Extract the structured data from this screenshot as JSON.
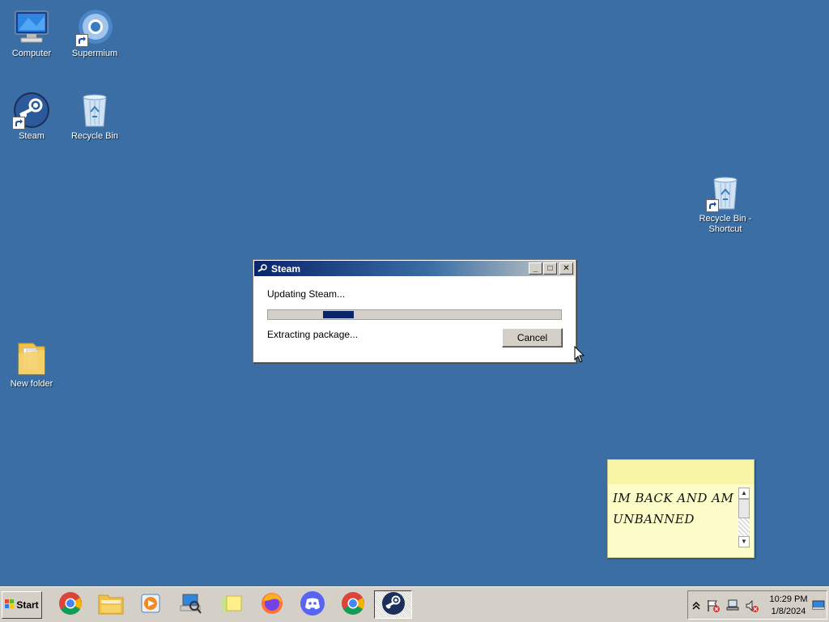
{
  "desktop": {
    "icons": [
      {
        "label": "Computer"
      },
      {
        "label": "Supermium"
      },
      {
        "label": "Steam"
      },
      {
        "label": "Recycle Bin"
      },
      {
        "label": "Recycle Bin - Shortcut"
      },
      {
        "label": "New folder"
      }
    ]
  },
  "dialog": {
    "title": "Steam",
    "status_title": "Updating Steam...",
    "status_sub": "Extracting package...",
    "cancel_label": "Cancel",
    "progress_state": "indeterminate",
    "title_buttons": [
      "minimize",
      "maximize",
      "close"
    ]
  },
  "sticky_note": {
    "text": "IM BACK AND AM UNBANNED"
  },
  "taskbar": {
    "start_label": "Start",
    "pinned": [
      "chrome-icon",
      "file-explorer-icon",
      "media-player-icon",
      "network-search-icon",
      "sticky-notes-icon",
      "firefox-icon",
      "discord-icon",
      "chrome-icon",
      "steam-icon"
    ],
    "active_app": "steam-icon",
    "clock_time": "10:29 PM",
    "clock_date": "1/8/2024"
  },
  "colors": {
    "desktop": "#3a6ea5",
    "title_dark": "#0a246a",
    "progress_fill": "#0a246a",
    "sticky": "#fdfdc9"
  }
}
